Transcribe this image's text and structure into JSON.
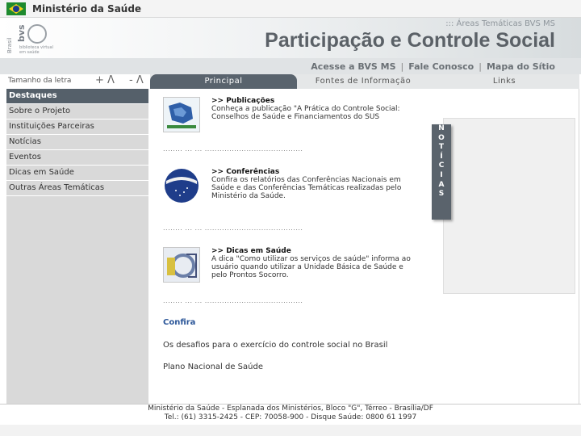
{
  "govbar": {
    "ministry": "Ministério da Saúde"
  },
  "header": {
    "logo_side": "Brasil",
    "logo_word": "bvs",
    "logo_sub": "biblioteca virtual em saúde",
    "areas_link": "::: Áreas Temáticas BVS MS",
    "title": "Participação e Controle Social"
  },
  "topnav": {
    "acesse": "Acesse a BVS MS",
    "fale": "Fale Conosco",
    "mapa": "Mapa do Sítio"
  },
  "fontsize": {
    "label": "Tamanho da letra",
    "plus": "+ Λ",
    "minus": "- Λ"
  },
  "sidebar": {
    "items": [
      {
        "label": "Destaques"
      },
      {
        "label": "Sobre o Projeto"
      },
      {
        "label": "Instituições Parceiras"
      },
      {
        "label": "Notícias"
      },
      {
        "label": "Eventos"
      },
      {
        "label": "Dicas em Saúde"
      },
      {
        "label": "Outras Áreas Temáticas"
      }
    ]
  },
  "tabs": {
    "principal": "Principal",
    "fontes": "Fontes de Informação",
    "links": "Links"
  },
  "content": {
    "items": [
      {
        "title": ">> Publicações",
        "text": "Conheça a publicação \"A Prática do Controle Social: Conselhos de Saúde e Financiamentos do SUS"
      },
      {
        "title": ">> Conferências",
        "text": "Confira os relatórios das Conferências Nacionais em Saúde e das Conferências Temáticas realizadas pelo Ministério da Saúde."
      },
      {
        "title": ">> Dicas em Saúde",
        "text": "A dica \"Como utilizar os serviços de saúde\" informa ao usuário quando utilizar a Unidade Básica de Saúde e pelo Prontos Socorro."
      }
    ],
    "dots": "........ ... ... ........................................",
    "confira": "Confira",
    "link1": "Os desafios para o exercício do controle social no Brasil",
    "link2": "Plano Nacional de Saúde"
  },
  "news_tab": [
    "N",
    "O",
    "T",
    "Í",
    "C",
    "I",
    "A",
    "S"
  ],
  "footer": {
    "line1": "Ministério da Saúde - Esplanada dos Ministérios, Bloco \"G\", Térreo - Brasília/DF",
    "line2": "Tel.: (61) 3315-2425 - CEP: 70058-900 - Disque Saúde: 0800 61 1997"
  }
}
